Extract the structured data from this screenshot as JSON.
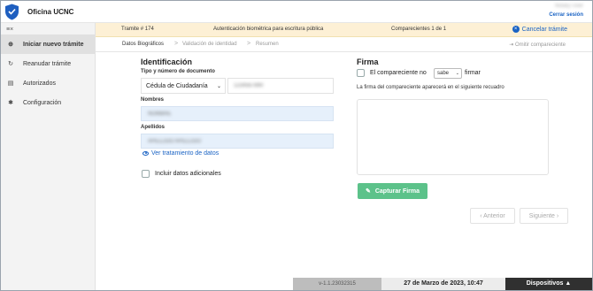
{
  "app": {
    "title": "Oficina UCNC",
    "user_name": "Notary User",
    "logout_label": "Cerrar sesión"
  },
  "sidebar": {
    "toggle_icon": "≡×",
    "items": [
      {
        "label": "Iniciar nuevo trámite",
        "icon": "⊕",
        "active": true
      },
      {
        "label": "Reanudar trámite",
        "icon": "↻",
        "active": false
      },
      {
        "label": "Autorizados",
        "icon": "▤",
        "active": false
      },
      {
        "label": "Configuración",
        "icon": "✱",
        "active": false
      }
    ]
  },
  "tramite": {
    "number": "Tramite # 174",
    "description": "Autenticación biométrica para escritura pública",
    "comparecientes": "Comparecientes 1 de 1",
    "cancel_label": "Cancelar trámite",
    "cancel_icon": "×"
  },
  "steps": {
    "items": [
      "Datos Biográficos",
      "Validación de identidad",
      "Resumen"
    ],
    "separator": ">",
    "omit_label": "Omitir compareciente",
    "omit_icon": "⇥"
  },
  "identificacion": {
    "title": "Identificación",
    "doc_label": "Tipo y número de documento",
    "doc_type": "Cédula de Ciudadanía",
    "doc_caret": "⌄",
    "doc_number": "1234567890",
    "nombres_label": "Nombres",
    "nombres_value": "NOMBRE",
    "apellidos_label": "Apellidos",
    "apellidos_value": "APELLIDO APELLIDO",
    "ver_datos_link": "Ver tratamiento de datos",
    "datos_adicionales_label": "Incluir datos adicionales"
  },
  "firma": {
    "title": "Firma",
    "prefix": "El compareciente no",
    "select_value": "sabe",
    "select_caret": "⌄",
    "suffix": "firmar",
    "note": "La firma del compareciente aparecerá en el siguiente recuadro",
    "capture_label": "Capturar Firma",
    "capture_icon": "✎"
  },
  "nav": {
    "prev_label": "‹ Anterior",
    "next_label": "Siguiente ›"
  },
  "footer": {
    "version": "v-1.1.23032315",
    "datetime": "27 de Marzo de 2023, 10:47",
    "devices_label": "Dispositivos ▲"
  },
  "colors": {
    "accent": "#1a63c4",
    "tramite_bar": "#fdf0d5",
    "capture_button": "#5cc28a",
    "input_fill": "#e6f0fb"
  }
}
